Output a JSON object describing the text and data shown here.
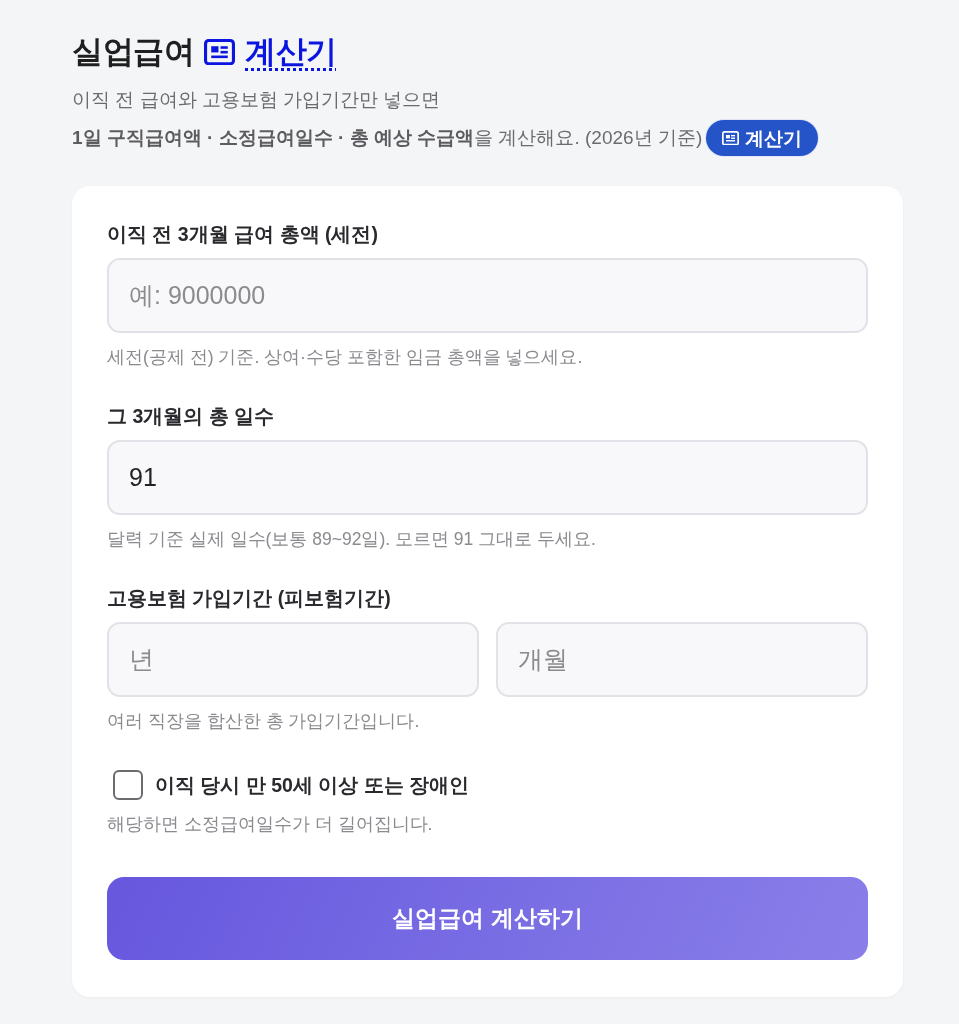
{
  "header": {
    "title": "실업급여",
    "title_link": "계산기",
    "subtitle": "이직 전 급여와 고용보험 가입기간만 넣으면",
    "summary": "**1일 구직급여액 · 소정급여일수 · 총 예상 수급액**을 계산해요. (2026년 기준)",
    "badge": "계산기"
  },
  "form": {
    "fields": [
      {
        "label": "이직 전 3개월 급여 총액 (세전)",
        "inputs": [
          {
            "placeholder": "예: 9000000"
          }
        ],
        "hint": "세전(공제 전) 기준. 상여·수당 포함한 임금 총액을 넣으세요."
      },
      {
        "label": "그 3개월의 총 일수",
        "inputs": [
          {
            "value": "91"
          }
        ],
        "hint": "달력 기준 실제 일수(보통 89~92일). 모르면 91 그대로 두세요."
      },
      {
        "label": "고용보험 가입기간 (피보험기간)",
        "inputs": [
          {
            "placeholder": "년"
          },
          {
            "placeholder": "개월"
          }
        ],
        "hint": "여러 직장을 합산한 총 가입기간입니다."
      }
    ],
    "checkbox": {
      "label": "이직 당시 만 50세 이상 또는 장애인",
      "checked": false,
      "hint": "해당하면 소정급여일수가 더 길어집니다."
    },
    "submit": "실업급여 계산하기"
  }
}
